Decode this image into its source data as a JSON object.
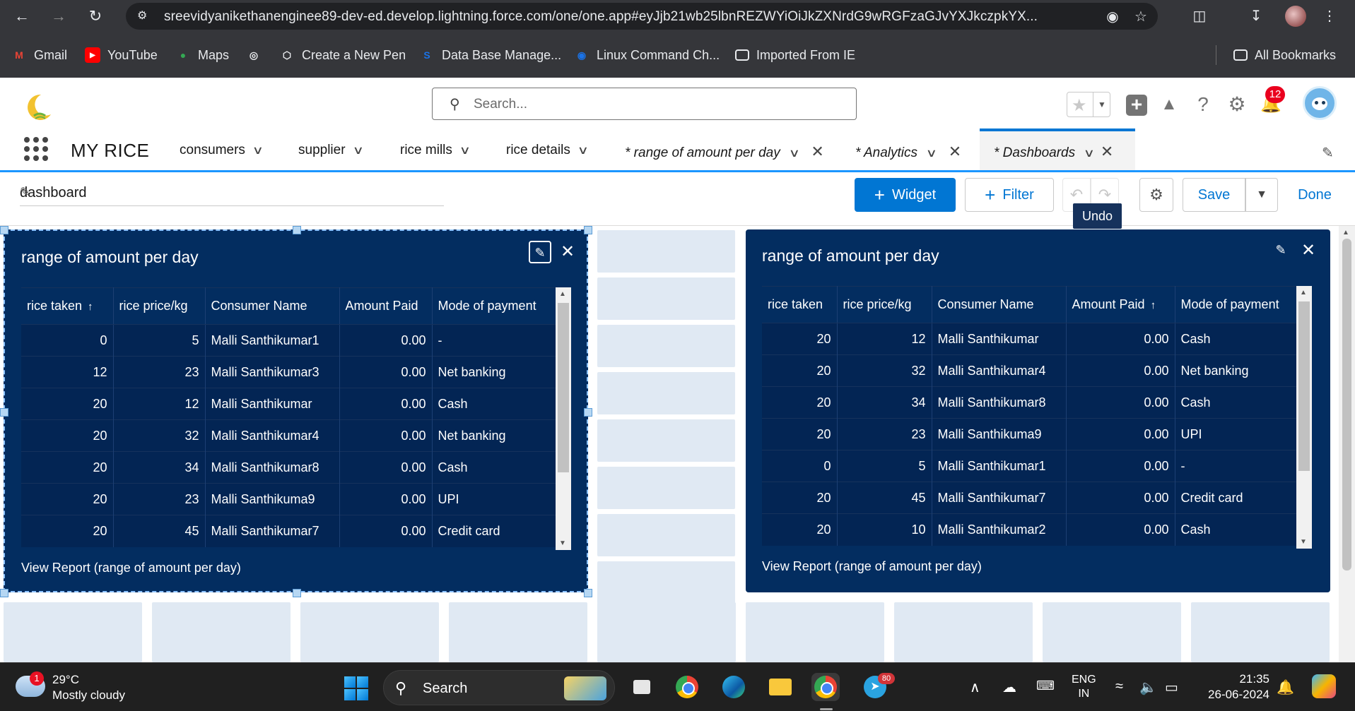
{
  "browser": {
    "url": "sreevidyanikethanenginee89-dev-ed.develop.lightning.force.com/one/one.app#eyJjb21wb25lbnREZWYiOiJkZXNrdG9wRGFzaGJvYXJkczpkYX...",
    "bookmarks": [
      {
        "label": "Gmail",
        "icon": "gmail-icon",
        "color": "#ea4335"
      },
      {
        "label": "YouTube",
        "icon": "youtube-icon",
        "color": "#ff0000"
      },
      {
        "label": "Maps",
        "icon": "maps-icon",
        "color": "#34a853"
      },
      {
        "label": "",
        "icon": "globe-icon",
        "color": "#e8eaed"
      },
      {
        "label": "Create a New Pen",
        "icon": "codepen-icon",
        "color": "#e8eaed"
      },
      {
        "label": "Data Base Manage...",
        "icon": "s-icon",
        "color": "#1a73e8"
      },
      {
        "label": "Linux Command Ch...",
        "icon": "linux-icon",
        "color": "#1a73e8"
      },
      {
        "label": "Imported From IE",
        "icon": "folder-icon",
        "color": "#e8eaed"
      }
    ],
    "all_bookmarks": "All Bookmarks"
  },
  "header": {
    "search_placeholder": "Search...",
    "notification_count": "12"
  },
  "nav": {
    "app_name": "MY RICE",
    "items": [
      "consumers",
      "supplier",
      "rice mills",
      "rice details"
    ],
    "tabs": [
      "* range of amount per day",
      "* Analytics",
      "* Dashboards"
    ]
  },
  "builder": {
    "dashboard_name": "dashboard",
    "widget_label": "Widget",
    "filter_label": "Filter",
    "save_label": "Save",
    "done_label": "Done",
    "tooltip": "Undo"
  },
  "widgets": [
    {
      "title": "range of amount per day",
      "columns": [
        "rice taken",
        "rice price/kg",
        "Consumer Name",
        "Amount Paid",
        "Mode of payment"
      ],
      "sort_column": 0,
      "rows": [
        [
          "0",
          "5",
          "Malli Santhikumar1",
          "0.00",
          "-"
        ],
        [
          "12",
          "23",
          "Malli Santhikumar3",
          "0.00",
          "Net banking"
        ],
        [
          "20",
          "12",
          "Malli Santhikumar",
          "0.00",
          "Cash"
        ],
        [
          "20",
          "32",
          "Malli Santhikumar4",
          "0.00",
          "Net banking"
        ],
        [
          "20",
          "34",
          "Malli Santhikumar8",
          "0.00",
          "Cash"
        ],
        [
          "20",
          "23",
          "Malli Santhikuma9",
          "0.00",
          "UPI"
        ],
        [
          "20",
          "45",
          "Malli Santhikumar7",
          "0.00",
          "Credit card"
        ]
      ],
      "footer": "View Report (range of amount per day)"
    },
    {
      "title": "range of amount per day",
      "columns": [
        "rice taken",
        "rice price/kg",
        "Consumer Name",
        "Amount Paid",
        "Mode of payment"
      ],
      "sort_column": 3,
      "rows": [
        [
          "20",
          "12",
          "Malli Santhikumar",
          "0.00",
          "Cash"
        ],
        [
          "20",
          "32",
          "Malli Santhikumar4",
          "0.00",
          "Net banking"
        ],
        [
          "20",
          "34",
          "Malli Santhikumar8",
          "0.00",
          "Cash"
        ],
        [
          "20",
          "23",
          "Malli Santhikuma9",
          "0.00",
          "UPI"
        ],
        [
          "0",
          "5",
          "Malli Santhikumar1",
          "0.00",
          "-"
        ],
        [
          "20",
          "45",
          "Malli Santhikumar7",
          "0.00",
          "Credit card"
        ],
        [
          "20",
          "10",
          "Malli Santhikumar2",
          "0.00",
          "Cash"
        ]
      ],
      "footer": "View Report (range of amount per day)"
    }
  ],
  "taskbar": {
    "weather_badge": "1",
    "temperature": "29°C",
    "condition": "Mostly cloudy",
    "search_label": "Search",
    "telegram_badge": "80",
    "lang_line1": "ENG",
    "lang_line2": "IN",
    "time": "21:35",
    "date": "26-06-2024"
  },
  "colors": {
    "brand_blue": "#0176d3",
    "widget_bg": "#032d60",
    "nav_accent": "#1b96ff"
  }
}
